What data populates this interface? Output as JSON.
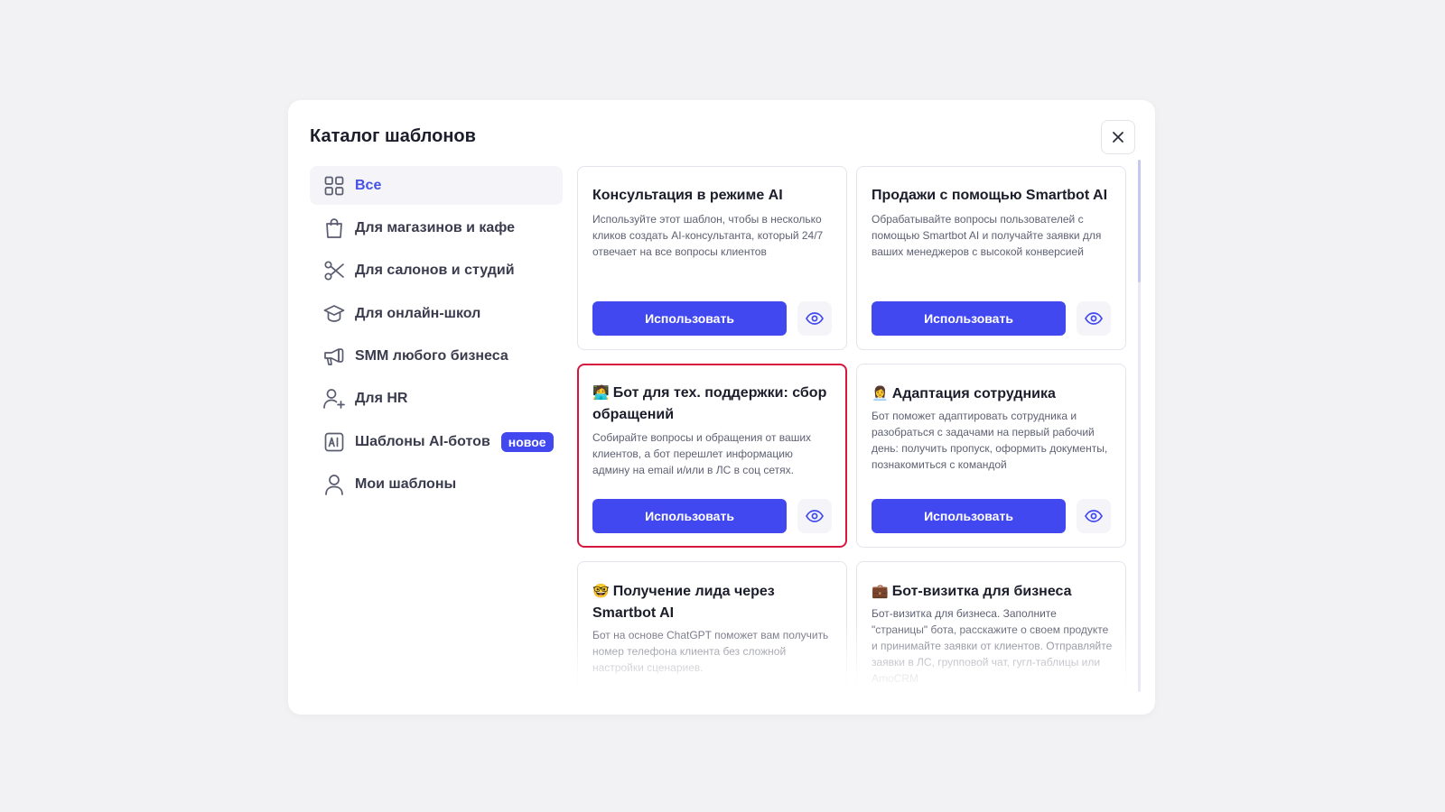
{
  "modal": {
    "title": "Каталог шаблонов",
    "close_icon": "close-icon"
  },
  "sidebar": {
    "items": [
      {
        "label": "Все",
        "icon": "grid-icon",
        "active": true
      },
      {
        "label": "Для магазинов и кафе",
        "icon": "shopping-bag-icon"
      },
      {
        "label": "Для салонов и студий",
        "icon": "scissors-icon"
      },
      {
        "label": "Для онлайн-школ",
        "icon": "graduation-cap-icon"
      },
      {
        "label": "SMM любого бизнеса",
        "icon": "megaphone-icon"
      },
      {
        "label": "Для HR",
        "icon": "user-plus-icon"
      },
      {
        "label": "Шаблоны AI-ботов",
        "icon": "ai-icon",
        "badge": "новое"
      },
      {
        "label": "Мои шаблоны",
        "icon": "user-icon"
      }
    ]
  },
  "cards": [
    {
      "emoji": "",
      "title": "Консультация в режиме AI",
      "description": "Используйте этот шаблон, чтобы в несколько кликов создать AI-консультанта, который 24/7 отвечает на все вопросы клиентов",
      "button": "Использовать"
    },
    {
      "emoji": "",
      "title": "Продажи с помощью Smartbot AI",
      "description": "Обрабатывайте вопросы пользователей с помощью Smartbot AI и получайте заявки для ваших менеджеров с высокой конверсией",
      "button": "Использовать"
    },
    {
      "emoji": "🧑‍💻",
      "title": "Бот для тех. поддержки: сбор обращений",
      "description": "Собирайте вопросы и обращения от ваших клиентов, а бот перешлет информацию админу на email и/или в ЛС в соц сетях.",
      "button": "Использовать",
      "selected": true
    },
    {
      "emoji": "👩‍💼",
      "title": "Адаптация сотрудника",
      "description": "Бот поможет адаптировать сотрудника и разобраться с задачами на первый рабочий день: получить пропуск, оформить документы, познакомиться с командой",
      "button": "Использовать"
    },
    {
      "emoji": "🤓",
      "title": "Получение лида через Smartbot AI",
      "description": "Бот на основе ChatGPT поможет вам получить номер телефона клиента без сложной настройки сценариев."
    },
    {
      "emoji": "💼",
      "title": "Бот-визитка для бизнеса",
      "description": "Бот-визитка для бизнеса. Заполните \"страницы\" бота, расскажите о своем продукте и принимайте заявки от клиентов. Отправляйте заявки в ЛС, групповой чат, гугл-таблицы или AmoCRM"
    }
  ],
  "colors": {
    "accent": "#4148ef",
    "active_label": "#4452e8",
    "selected_border": "#d6183f"
  }
}
